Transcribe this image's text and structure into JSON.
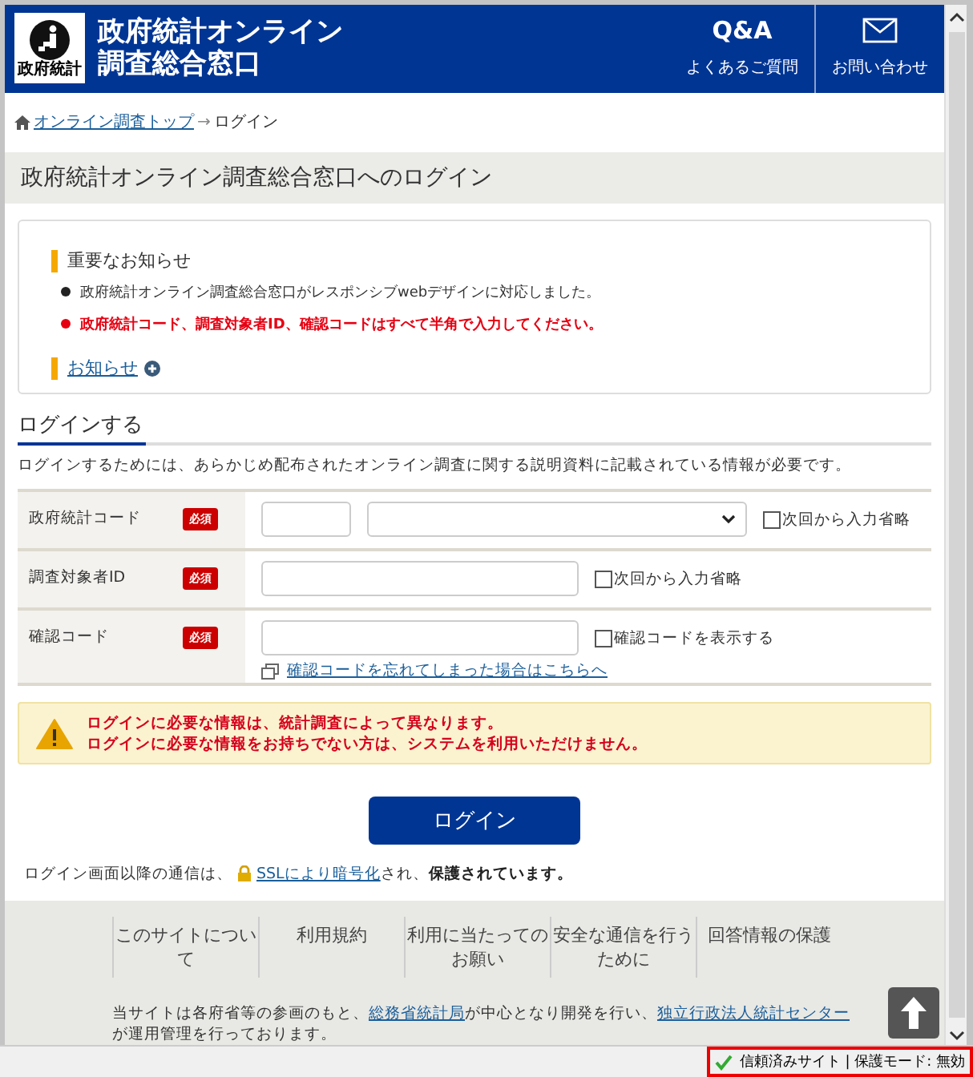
{
  "header": {
    "logo_caption": "政府統計",
    "site_title": [
      "政府統計オンライン",
      "調査総合窓口"
    ],
    "nav": [
      {
        "kind": "qa",
        "mark": "Q&A",
        "label": "よくあるご質問"
      },
      {
        "kind": "mail",
        "label": "お問い合わせ"
      }
    ]
  },
  "breadcrumb": {
    "link": "オンライン調査トップ",
    "separator": "→",
    "current": "ログイン"
  },
  "page_title": "政府統計オンライン調査総合窓口へのログイン",
  "notice": {
    "heading": "重要なお知らせ",
    "items": [
      {
        "text": "政府統計オンライン調査総合窓口がレスポンシブwebデザインに対応しました。",
        "important": false
      },
      {
        "text": "政府統計コード、調査対象者ID、確認コードはすべて半角で入力してください。",
        "important": true
      }
    ],
    "link": "お知らせ"
  },
  "login": {
    "heading": "ログインする",
    "description": "ログインするためには、あらかじめ配布されたオンライン調査に関する説明資料に記載されている情報が必要です。",
    "fields": [
      {
        "kind": "code",
        "label": "政府統計コード",
        "badge": "必須",
        "checkbox": {
          "label": "次回から入力省略",
          "checked": false
        }
      },
      {
        "kind": "text",
        "label": "調査対象者ID",
        "badge": "必須",
        "checkbox": {
          "label": "次回から入力省略",
          "checked": false
        }
      },
      {
        "kind": "password",
        "label": "確認コード",
        "badge": "必須",
        "checkbox": {
          "label": "確認コードを表示する",
          "checked": false
        },
        "link": "確認コードを忘れてしまった場合はこちらへ"
      }
    ],
    "warning": [
      "ログインに必要な情報は、統計調査によって異なります。",
      "ログインに必要な情報をお持ちでない方は、システムを利用いただけません。"
    ],
    "button": "ログイン",
    "security": [
      {
        "kind": "text",
        "text": "ログイン画面以降の通信は、"
      },
      {
        "kind": "link",
        "text": "SSLにより暗号化"
      },
      {
        "kind": "text",
        "text": "され、**保護されています。**"
      }
    ]
  },
  "footer": {
    "links": [
      "このサイトについて",
      "利用規約",
      "利用に当たってのお願い",
      "安全な通信を行うために",
      "回答情報の保護"
    ],
    "note": [
      {
        "kind": "text",
        "text": "当サイトは各府省等の参画のもと、"
      },
      {
        "kind": "link",
        "text": "総務省統計局"
      },
      {
        "kind": "text",
        "text": "が中心となり開発を行い、"
      },
      {
        "kind": "link",
        "text": "独立行政法人統計センター"
      },
      {
        "kind": "text",
        "text": "が運用管理を行っております。"
      }
    ]
  },
  "status_bar": {
    "zone": "信頼済みサイト | 保護モード: 無効"
  }
}
